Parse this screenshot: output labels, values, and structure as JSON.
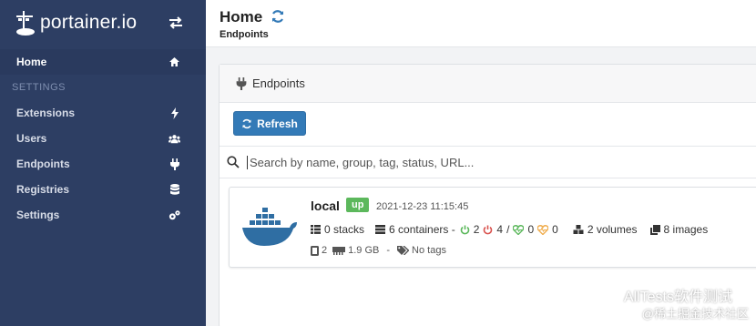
{
  "brand": {
    "name": "portainer.io"
  },
  "sidebar": {
    "items": [
      {
        "label": "Home",
        "icon": "home-icon"
      },
      {
        "label": "Extensions",
        "icon": "bolt-icon"
      },
      {
        "label": "Users",
        "icon": "users-icon"
      },
      {
        "label": "Endpoints",
        "icon": "plug-icon"
      },
      {
        "label": "Registries",
        "icon": "database-icon"
      },
      {
        "label": "Settings",
        "icon": "cogs-icon"
      }
    ],
    "section": "SETTINGS"
  },
  "header": {
    "title": "Home",
    "breadcrumb": "Endpoints"
  },
  "panel": {
    "title": "Endpoints",
    "refresh_label": "Refresh",
    "search_placeholder": "Search by name, group, tag, status, URL..."
  },
  "endpoint": {
    "name": "local",
    "status": "up",
    "timestamp": "2021-12-23 11:15:45",
    "stacks": "0 stacks",
    "containers": "6 containers -",
    "running": "2",
    "stopped": "4",
    "separator": "/",
    "healthy": "0",
    "unhealthy": "0",
    "volumes": "2 volumes",
    "images": "8 images",
    "cpu": "2",
    "memory": "1.9 GB",
    "dash": "-",
    "tags": "No tags"
  },
  "watermark": {
    "line1": "AllTests软件测试",
    "line2": "@稀土掘金技术社区"
  },
  "colors": {
    "sidebar": "#2d3e63",
    "primary": "#337ab7",
    "success": "#5cb85c",
    "docker": "#2f6ea3"
  }
}
